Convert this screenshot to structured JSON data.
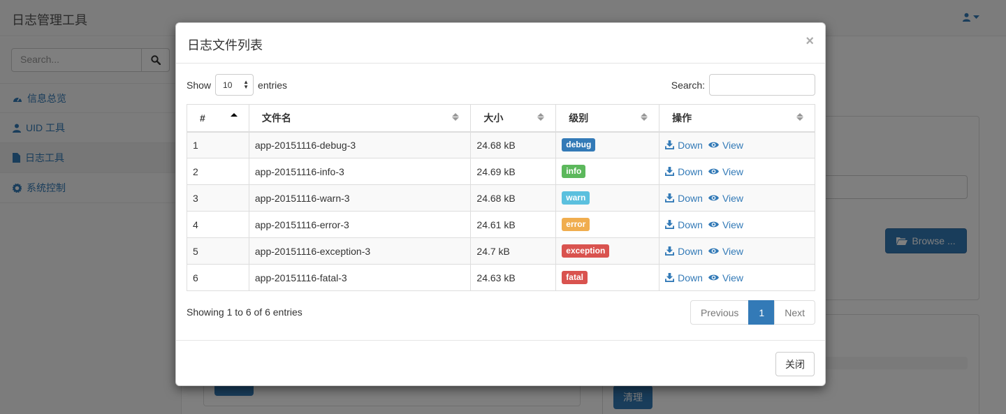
{
  "app": {
    "title": "日志管理工具"
  },
  "sidebar": {
    "search_placeholder": "Search...",
    "items": [
      {
        "label": "信息总览",
        "icon": "dashboard-icon"
      },
      {
        "label": "UID 工具",
        "icon": "user-icon"
      },
      {
        "label": "日志工具",
        "icon": "file-icon",
        "active": true
      },
      {
        "label": "系统控制",
        "icon": "gear-icon"
      }
    ]
  },
  "background": {
    "browse_label": "Browse ...",
    "clear_label": "清理"
  },
  "modal": {
    "title": "日志文件列表",
    "close_symbol": "×",
    "show_label": "Show",
    "entries_value": "10",
    "entries_label": "entries",
    "search_label": "Search:",
    "columns": [
      "#",
      "文件名",
      "大小",
      "级别",
      "操作"
    ],
    "rows": [
      {
        "num": "1",
        "file": "app-20151116-debug-3",
        "size": "24.68 kB",
        "level": "debug",
        "color": "#337ab7"
      },
      {
        "num": "2",
        "file": "app-20151116-info-3",
        "size": "24.69 kB",
        "level": "info",
        "color": "#5cb85c"
      },
      {
        "num": "3",
        "file": "app-20151116-warn-3",
        "size": "24.68 kB",
        "level": "warn",
        "color": "#5bc0de"
      },
      {
        "num": "4",
        "file": "app-20151116-error-3",
        "size": "24.61 kB",
        "level": "error",
        "color": "#f0ad4e"
      },
      {
        "num": "5",
        "file": "app-20151116-exception-3",
        "size": "24.7 kB",
        "level": "exception",
        "color": "#d9534f"
      },
      {
        "num": "6",
        "file": "app-20151116-fatal-3",
        "size": "24.63 kB",
        "level": "fatal",
        "color": "#d9534f"
      }
    ],
    "action_down": "Down",
    "action_view": "View",
    "info_text": "Showing 1 to 6 of 6 entries",
    "pager": {
      "previous": "Previous",
      "current": "1",
      "next": "Next"
    },
    "close_button": "关闭"
  },
  "colors": {
    "primary": "#337ab7"
  }
}
